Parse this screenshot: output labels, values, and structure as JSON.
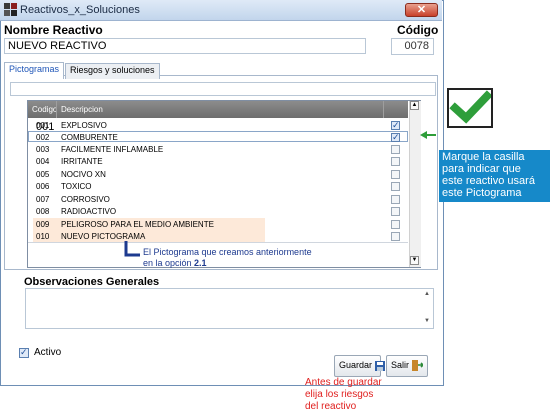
{
  "window": {
    "title": "Reactivos_x_Soluciones",
    "close_glyph": "✕"
  },
  "form": {
    "name_label": "Nombre Reactivo",
    "name_value": "NUEVO REACTIVO",
    "code_label": "Código",
    "code_value": "0078"
  },
  "tabs": [
    {
      "label": "Pictogramas",
      "active": true
    },
    {
      "label": "Riesgos y soluciones",
      "active": false
    }
  ],
  "grid": {
    "columns": [
      "Codigo",
      "Descripcion"
    ],
    "rows": [
      {
        "code": "001",
        "desc": "EXPLOSIVO",
        "checked": true
      },
      {
        "code": "002",
        "desc": "COMBURENTE",
        "checked": true
      },
      {
        "code": "003",
        "desc": "FACILMENTE INFLAMABLE",
        "checked": false
      },
      {
        "code": "004",
        "desc": "IRRITANTE",
        "checked": false
      },
      {
        "code": "005",
        "desc": "NOCIVO XN",
        "checked": false
      },
      {
        "code": "006",
        "desc": "TOXICO",
        "checked": false
      },
      {
        "code": "007",
        "desc": "CORROSIVO",
        "checked": false
      },
      {
        "code": "008",
        "desc": "RADIOACTIVO",
        "checked": false
      },
      {
        "code": "009",
        "desc": "PELIGROSO PARA EL MEDIO AMBIENTE",
        "checked": false
      },
      {
        "code": "010",
        "desc": "NUEVO PICTOGRAMA",
        "checked": false
      }
    ]
  },
  "observations": {
    "label": "Observaciones Generales"
  },
  "active": {
    "label": "Activo",
    "checked": true
  },
  "buttons": {
    "save": "Guardar",
    "exit": "Salir"
  },
  "annotations": {
    "grid_note_line1": "El Pictograma que creamos anteriormente",
    "grid_note_line2_prefix": "en la opción ",
    "grid_note_line2_bold": "2.1",
    "callout_lines": [
      "Marque la casilla",
      "para indicar que",
      "este reactivo usará",
      "este Pictograma"
    ],
    "save_note_lines": [
      "Antes de guardar",
      "elija los riesgos",
      "del reactivo"
    ]
  },
  "colors": {
    "accent_green": "#2e9e3a",
    "callout_blue": "#1689c9",
    "note_red": "#e0201f",
    "highlight_row": "#fde9d9"
  },
  "icons": [
    "app-icon",
    "close-icon",
    "save-disk-icon",
    "exit-door-icon",
    "big-green-check-icon",
    "green-arrow-icon"
  ]
}
